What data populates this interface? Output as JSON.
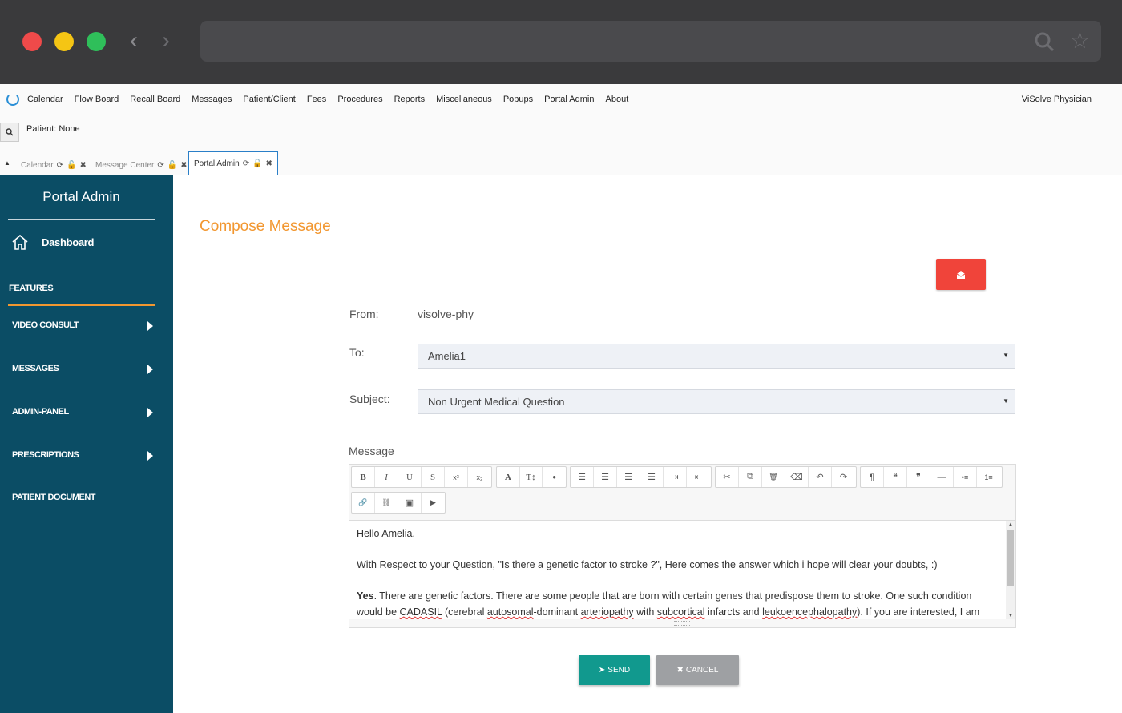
{
  "browser": {
    "icons": {
      "back": "chevron-left-icon",
      "forward": "chevron-right-icon",
      "search": "search-icon",
      "bookmark": "star-icon"
    }
  },
  "menubar": {
    "items": [
      "Calendar",
      "Flow Board",
      "Recall Board",
      "Messages",
      "Patient/Client",
      "Fees",
      "Procedures",
      "Reports",
      "Miscellaneous",
      "Popups",
      "Portal Admin",
      "About"
    ],
    "user": "ViSolve Physician"
  },
  "patient": {
    "label": "Patient: None"
  },
  "tabs": [
    {
      "label": "Calendar",
      "active": false
    },
    {
      "label": "Message Center",
      "active": false
    },
    {
      "label": "Portal Admin",
      "active": true
    }
  ],
  "sidebar": {
    "title": "Portal Admin",
    "dashboard": "Dashboard",
    "section": "FEATURES",
    "items": [
      "VIDEO CONSULT",
      "MESSAGES",
      "ADMIN-PANEL",
      "PRESCRIPTIONS",
      "PATIENT DOCUMENT"
    ]
  },
  "compose": {
    "title": "Compose Message",
    "from_label": "From:",
    "from_value": "visolve-phy",
    "to_label": "To:",
    "to_value": "Amelia1",
    "subject_label": "Subject:",
    "subject_value": "Non Urgent Medical Question",
    "message_label": "Message",
    "body": {
      "greeting": "Hello Amelia,",
      "line2": "With Respect to your Question, \"Is there a genetic factor to stroke ?\", Here comes the answer which i hope will clear your doubts, :)",
      "yes": "Yes",
      "p3a": ". There are genetic factors. There are some people that are born with certain genes that predispose them to stroke. One such condition would be ",
      "cadasil": "CADASIL",
      "p3b": " (cerebral ",
      "autosomal": "autosomal",
      "p3c": "-dominant ",
      "arteriopathy": "arteriopathy",
      "p3d": " with ",
      "subcortical": "subcortical",
      "p3e": " infarcts and ",
      "leuko": "leukoencephalopathy",
      "p3f": "). If you are interested, I am"
    },
    "send": "SEND",
    "cancel": "CANCEL"
  },
  "toolbar_groups": [
    [
      "B",
      "I",
      "U",
      "S",
      "x²",
      "x₂"
    ],
    [
      "A",
      "T↕",
      "●"
    ],
    [
      "≡L",
      "≡C",
      "≡R",
      "≡J",
      "⇥",
      "⇤"
    ],
    [
      "✂",
      "⧉",
      "🗑",
      "⌫",
      "↶",
      "↷"
    ],
    [
      "¶",
      "❝",
      "❞",
      "—",
      "•≡",
      "1≡"
    ],
    [
      "🔗",
      "⛓",
      "▣",
      "▶"
    ]
  ],
  "colors": {
    "accent": "#f29730",
    "sidebar": "#0b4d65",
    "send": "#11998e",
    "cancel": "#9ea0a3",
    "danger": "#f0443a"
  }
}
